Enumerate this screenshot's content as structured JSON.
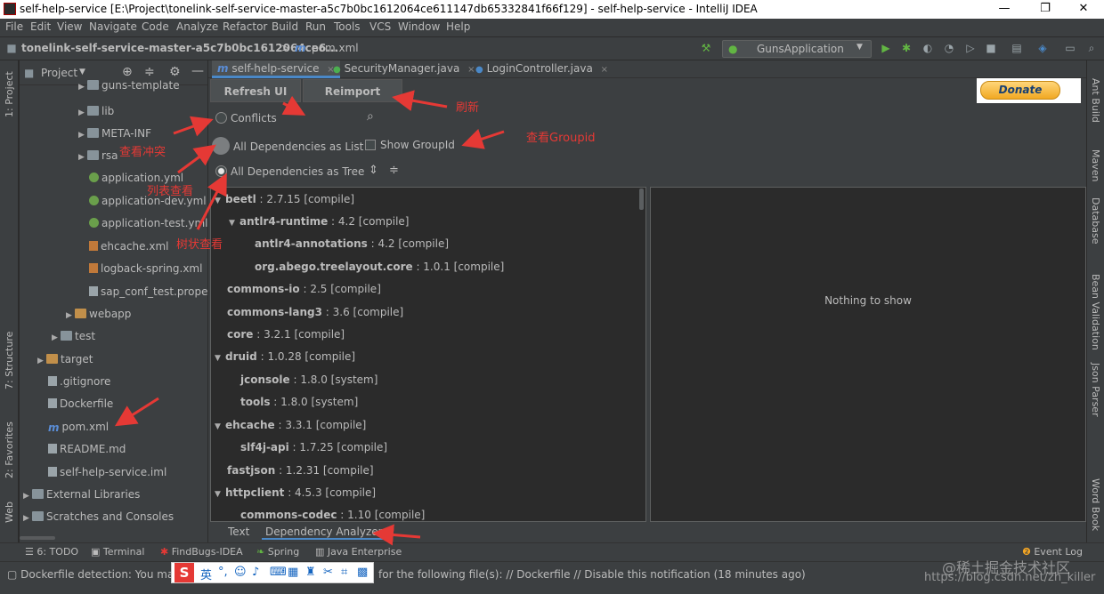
{
  "window": {
    "title": "self-help-service [E:\\Project\\tonelink-self-service-master-a5c7b0bc1612064ce611147db65332841f66f129] - self-help-service - IntelliJ IDEA",
    "minimize_glyph": "—",
    "maximize_glyph": "❐",
    "close_glyph": "✕"
  },
  "menu": [
    "File",
    "Edit",
    "View",
    "Navigate",
    "Code",
    "Analyze",
    "Refactor",
    "Build",
    "Run",
    "Tools",
    "VCS",
    "Window",
    "Help"
  ],
  "navbar": {
    "project": "tonelink-self-service-master-a5c7b0bc1612064ce6...",
    "separator": ">",
    "file": "pom.xml",
    "run_config": "GunsApplication"
  },
  "left_strip": [
    "1: Project",
    "7: Structure",
    "2: Favorites",
    "Web"
  ],
  "right_strip": [
    "Ant Build",
    "Maven",
    "Database",
    "Bean Validation",
    "Json Parser",
    "Word Book"
  ],
  "project_panel": {
    "title": "Project",
    "items": [
      {
        "label": "guns-template",
        "arrow": "▶"
      },
      {
        "label": "lib",
        "arrow": "▶"
      },
      {
        "label": "META-INF",
        "arrow": "▶"
      },
      {
        "label": "rsa",
        "arrow": "▶"
      },
      {
        "label": "application.yml",
        "arrow": ""
      },
      {
        "label": "application-dev.yml",
        "arrow": ""
      },
      {
        "label": "application-test.yml",
        "arrow": ""
      },
      {
        "label": "ehcache.xml",
        "arrow": ""
      },
      {
        "label": "logback-spring.xml",
        "arrow": ""
      },
      {
        "label": "sap_conf_test.properties",
        "arrow": ""
      },
      {
        "label": "webapp",
        "arrow": "▶"
      },
      {
        "label": "test",
        "arrow": "▶"
      },
      {
        "label": "target",
        "arrow": "▶"
      },
      {
        "label": ".gitignore",
        "arrow": ""
      },
      {
        "label": "Dockerfile",
        "arrow": ""
      },
      {
        "label": "pom.xml",
        "arrow": ""
      },
      {
        "label": "README.md",
        "arrow": ""
      },
      {
        "label": "self-help-service.iml",
        "arrow": ""
      },
      {
        "label": "External Libraries",
        "arrow": "▶"
      },
      {
        "label": "Scratches and Consoles",
        "arrow": "▶"
      }
    ]
  },
  "editor_tabs": [
    {
      "label": "self-help-service",
      "icon": "m",
      "close": "×"
    },
    {
      "label": "SecurityManager.java",
      "icon": "●",
      "close": "×"
    },
    {
      "label": "LoginController.java",
      "icon": "●",
      "close": "×"
    }
  ],
  "analyzer": {
    "refresh_label": "Refresh UI",
    "reimport_label": "Reimport",
    "conflicts_label": "Conflicts",
    "list_label": "All Dependencies as List",
    "tree_label": "All Dependencies as Tree",
    "show_groupid_label": "Show GroupId",
    "nothing_label": "Nothing to show"
  },
  "dependencies": [
    {
      "name": "beetl",
      "version": " : 2.7.15 [compile]",
      "arrow": "▼"
    },
    {
      "name": "antlr4-runtime",
      "version": " : 4.2 [compile]",
      "arrow": "▼"
    },
    {
      "name": "antlr4-annotations",
      "version": " : 4.2 [compile]",
      "arrow": ""
    },
    {
      "name": "org.abego.treelayout.core",
      "version": " : 1.0.1 [compile]",
      "arrow": ""
    },
    {
      "name": "commons-io",
      "version": " : 2.5 [compile]",
      "arrow": ""
    },
    {
      "name": "commons-lang3",
      "version": " : 3.6 [compile]",
      "arrow": ""
    },
    {
      "name": "core",
      "version": " : 3.2.1 [compile]",
      "arrow": ""
    },
    {
      "name": "druid",
      "version": " : 1.0.28 [compile]",
      "arrow": "▼"
    },
    {
      "name": "jconsole",
      "version": " : 1.8.0 [system]",
      "arrow": ""
    },
    {
      "name": "tools",
      "version": " : 1.8.0 [system]",
      "arrow": ""
    },
    {
      "name": "ehcache",
      "version": " : 3.3.1 [compile]",
      "arrow": "▼"
    },
    {
      "name": "slf4j-api",
      "version": " : 1.7.25 [compile]",
      "arrow": ""
    },
    {
      "name": "fastjson",
      "version": " : 1.2.31 [compile]",
      "arrow": ""
    },
    {
      "name": "httpclient",
      "version": " : 4.5.3 [compile]",
      "arrow": "▼"
    },
    {
      "name": "commons-codec",
      "version": " : 1.10 [compile]",
      "arrow": ""
    }
  ],
  "bottom_tabs": [
    "Text",
    "Dependency Analyzer"
  ],
  "toolwindows": [
    "6: TODO",
    "Terminal",
    "FindBugs-IDEA",
    "Spring",
    "Java Enterprise",
    "Event Log"
  ],
  "status": {
    "left": "Dockerfile detection: You may s",
    "right": "for the following file(s): // Dockerfile // Disable this notification (18 minutes ago)",
    "ime_logo": "S",
    "ime_mode": "英"
  },
  "donate_label": "Donate",
  "annotations": {
    "refresh": "刷新",
    "groupid": "查看Groupid",
    "conflicts": "查看冲突",
    "list": "列表查看",
    "tree": "树状查看"
  },
  "watermarks": {
    "juejin": "@稀土掘金技术社区",
    "csdn": "https://blog.csdn.net/zh_killer"
  },
  "colors": {
    "bg_dark": "#2b2b2b",
    "bg_panel": "#3c3f41",
    "accent": "#4a88c7",
    "annotation": "#e53935"
  }
}
